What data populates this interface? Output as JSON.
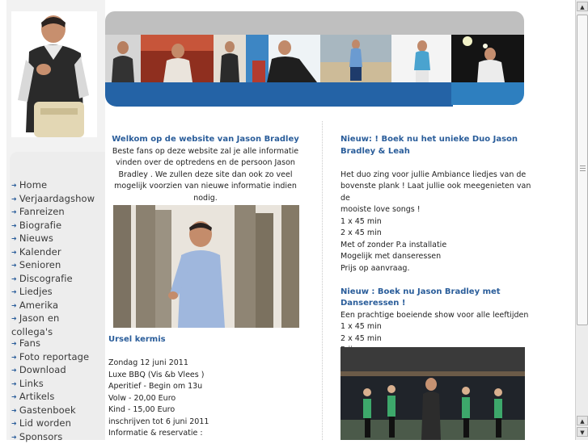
{
  "sidebar": {
    "items": [
      {
        "label": "Home"
      },
      {
        "label": "Verjaardagshow"
      },
      {
        "label": "Fanreizen"
      },
      {
        "label": "Biografie"
      },
      {
        "label": "Nieuws"
      },
      {
        "label": "Kalender"
      },
      {
        "label": "Senioren"
      },
      {
        "label": "Discografie"
      },
      {
        "label": "Liedjes"
      },
      {
        "label": "Amerika"
      },
      {
        "label": "Jason en collega's"
      },
      {
        "label": "Fans"
      },
      {
        "label": "Foto reportage"
      },
      {
        "label": "Download"
      },
      {
        "label": "Links"
      },
      {
        "label": "Artikels"
      },
      {
        "label": "Gastenboek"
      },
      {
        "label": "Lid worden"
      },
      {
        "label": "Sponsors"
      }
    ]
  },
  "main": {
    "left": {
      "welcome_title": "Welkom op de website van Jason Bradley",
      "welcome_lines": [
        "Beste fans op deze website zal je alle informatie",
        "vinden over de optredens en de persoon Jason",
        "Bradley . We zullen deze site dan ook zo veel",
        "mogelijk voorzien van nieuwe informatie indien nodig."
      ],
      "event_title": "Ursel kermis",
      "event_lines": [
        "Zondag 12 juni 2011",
        "Luxe BBQ (Vis &b Vlees )",
        "Aperitief - Begin om 13u",
        "Volw - 20,00 Euro",
        "Kind - 15,00 Euro",
        "inschrijven tot 6 juni 2011",
        "Informatie & reservatie :"
      ]
    },
    "right": {
      "news1_title": "Nieuw: ! Boek nu het unieke Duo Jason Bradley & Leah",
      "news1_lines": [
        "Het duo zing voor jullie Ambiance liedjes van de",
        "bovenste plank ! Laat jullie ook meegenieten van de",
        "mooiste love songs !",
        "1 x 45 min",
        "2 x 45 min",
        "Met of zonder P.a installatie",
        "Mogelijk met danseressen",
        "Prijs op aanvraag."
      ],
      "news2_title": "Nieuw : Boek nu Jason Bradley met Danseressen !",
      "news2_lines": [
        "Een prachtige boeiende show voor alle leeftijden",
        "1 x 45 min",
        "2 x 45 min",
        "Prijs op aanvraag"
      ]
    }
  },
  "colors": {
    "accent_blue": "#2a5d9a",
    "banner_blue": "#2463a6",
    "banner_gray": "#bfbfbf"
  },
  "scrollbar": {
    "up_icon": "arrow-up-icon",
    "down_icon": "arrow-down-icon"
  }
}
